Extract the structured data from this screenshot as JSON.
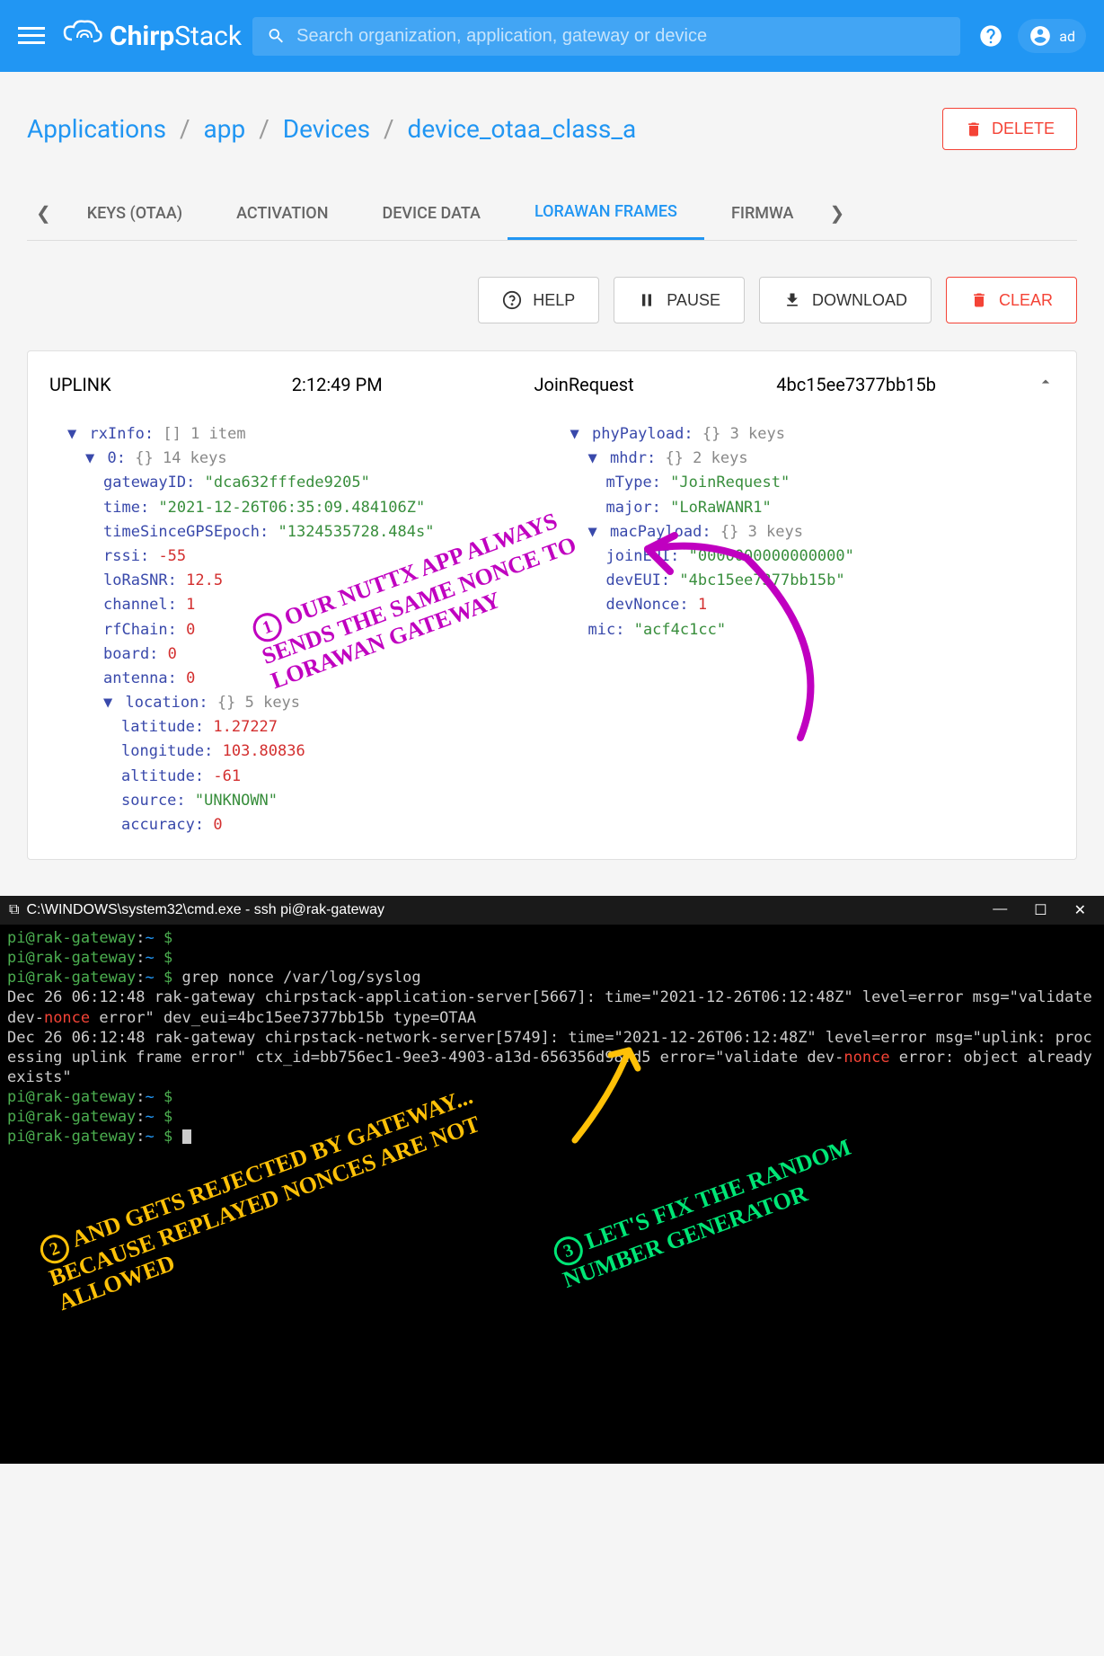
{
  "header": {
    "brand_bold": "Chirp",
    "brand_light": "Stack",
    "search_placeholder": "Search organization, application, gateway or device",
    "user_label": "ad"
  },
  "breadcrumb": {
    "applications": "Applications",
    "app": "app",
    "devices": "Devices",
    "device": "device_otaa_class_a"
  },
  "buttons": {
    "delete": "DELETE",
    "help": "HELP",
    "pause": "PAUSE",
    "download": "DOWNLOAD",
    "clear": "CLEAR"
  },
  "tabs": {
    "keys": "KEYS (OTAA)",
    "activation": "ACTIVATION",
    "device_data": "DEVICE DATA",
    "lorawan_frames": "LORAWAN FRAMES",
    "firmware": "FIRMWA"
  },
  "frame": {
    "direction": "UPLINK",
    "time": "2:12:49 PM",
    "type": "JoinRequest",
    "dev_eui": "4bc15ee7377bb15b"
  },
  "rxInfo": {
    "label": "rxInfo:",
    "count": "1 item",
    "idx0_label": "0:",
    "idx0_count": "14 keys",
    "gatewayID_k": "gatewayID:",
    "gatewayID_v": "\"dca632fffede9205\"",
    "time_k": "time:",
    "time_v": "\"2021-12-26T06:35:09.484106Z\"",
    "tsge_k": "timeSinceGPSEpoch:",
    "tsge_v": "\"1324535728.484s\"",
    "rssi_k": "rssi:",
    "rssi_v": "-55",
    "snr_k": "loRaSNR:",
    "snr_v": "12.5",
    "channel_k": "channel:",
    "channel_v": "1",
    "rfchain_k": "rfChain:",
    "rfchain_v": "0",
    "board_k": "board:",
    "board_v": "0",
    "antenna_k": "antenna:",
    "antenna_v": "0",
    "location_k": "location:",
    "location_count": "5 keys",
    "lat_k": "latitude:",
    "lat_v": "1.27227",
    "lon_k": "longitude:",
    "lon_v": "103.80836",
    "alt_k": "altitude:",
    "alt_v": "-61",
    "source_k": "source:",
    "source_v": "\"UNKNOWN\"",
    "accuracy_k": "accuracy:",
    "accuracy_v": "0"
  },
  "phyPayload": {
    "label": "phyPayload:",
    "count": "3 keys",
    "mhdr_k": "mhdr:",
    "mhdr_count": "2 keys",
    "mtype_k": "mType:",
    "mtype_v": "\"JoinRequest\"",
    "major_k": "major:",
    "major_v": "\"LoRaWANR1\"",
    "macpayload_k": "macPayload:",
    "macpayload_count": "3 keys",
    "joineui_k": "joinEUI:",
    "joineui_v": "\"0000000000000000\"",
    "deveui_k": "devEUI:",
    "deveui_v": "\"4bc15ee7377bb15b\"",
    "devnonce_k": "devNonce:",
    "devnonce_v": "1",
    "mic_k": "mic:",
    "mic_v": "\"acf4c1cc\""
  },
  "terminal": {
    "title": "C:\\WINDOWS\\system32\\cmd.exe - ssh  pi@rak-gateway",
    "prompt_user": "pi@rak-gateway",
    "prompt_sep": ":",
    "prompt_path": "~",
    "prompt_dollar": "$",
    "cmd": "grep nonce /var/log/syslog",
    "line1a": "Dec 26 06:12:48 rak-gateway chirpstack-application-server[5667]: time=\"2021-12-26T06:12:48Z\" level=error msg=\"validate dev-",
    "line1_nonce": "nonce",
    "line1b": " error\" dev_eui=4bc15ee7377bb15b type=OTAA",
    "line2a": "Dec 26 06:12:48 rak-gateway chirpstack-network-server[5749]: time=\"2021-12-26T06:12:48Z\" level=error msg=\"uplink: processing uplink frame error\" ctx_id=bb756ec1-9ee3-4903-a13d-656356d98fd5 error=\"validate dev-",
    "line2_nonce": "nonce",
    "line2b": " error: object already exists\""
  },
  "annotations": {
    "a1": "OUR NUTTX APP ALWAYS SENDS THE SAME NONCE TO LORAWAN GATEWAY",
    "a2": "AND GETS REJECTED BY GATEWAY... BECAUSE REPLAYED NONCES ARE NOT ALLOWED",
    "a3": "LET'S FIX THE RANDOM NUMBER GENERATOR"
  }
}
